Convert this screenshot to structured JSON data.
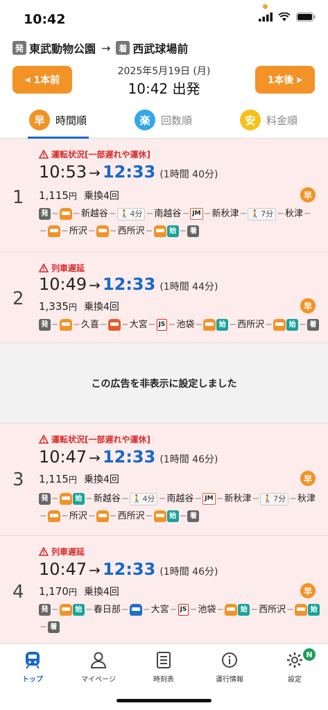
{
  "status": {
    "time": "10:42"
  },
  "route": {
    "from_badge": "発",
    "from": "東武動物公園",
    "arrow": "→",
    "to_badge": "着",
    "to": "西武球場前"
  },
  "nav": {
    "prev": "1本前",
    "next": "1本後",
    "date": "2025年5月19日 (月)",
    "departure": "10:42 出発"
  },
  "tabs": [
    {
      "icon": "早",
      "label": "時間順",
      "color": "#f39226"
    },
    {
      "icon": "楽",
      "label": "回数順",
      "color": "#35a6e8"
    },
    {
      "icon": "安",
      "label": "料金順",
      "color": "#f5c21b"
    }
  ],
  "results": [
    {
      "num": "1",
      "warning": "運転状況[一部遅れや運休]",
      "dep": "10:53",
      "arr": "12:33",
      "duration": "(1時間 40分)",
      "fare": "1,115",
      "yen": "円",
      "transfers": "乗換4回",
      "badge": "早",
      "stations": [
        "新越谷",
        "南越谷",
        "新秋津",
        "秋津",
        "所沢",
        "西所沢"
      ],
      "walk1": "4分",
      "walk2": "7分",
      "line": "JM",
      "start": "始",
      "dep_badge": "発",
      "arr_badge": "着"
    },
    {
      "num": "2",
      "warning": "列車遅延",
      "dep": "10:49",
      "arr": "12:33",
      "duration": "(1時間 44分)",
      "fare": "1,335",
      "yen": "円",
      "transfers": "乗換4回",
      "badge": "早",
      "stations": [
        "久喜",
        "大宮",
        "池袋",
        "西所沢"
      ],
      "line": "JS",
      "start": "始",
      "dep_badge": "発",
      "arr_badge": "着"
    },
    {
      "num": "3",
      "warning": "運転状況[一部遅れや運休]",
      "dep": "10:47",
      "arr": "12:33",
      "duration": "(1時間 46分)",
      "fare": "1,115",
      "yen": "円",
      "transfers": "乗換4回",
      "badge": "早",
      "stations": [
        "新越谷",
        "南越谷",
        "新秋津",
        "秋津",
        "所沢",
        "西所沢"
      ],
      "walk1": "4分",
      "walk2": "7分",
      "line": "JM",
      "start": "始",
      "dep_badge": "発",
      "arr_badge": "着"
    },
    {
      "num": "4",
      "warning": "列車遅延",
      "dep": "10:47",
      "arr": "12:33",
      "duration": "(1時間 46分)",
      "fare": "1,170",
      "yen": "円",
      "transfers": "乗換4回",
      "badge": "早",
      "stations": [
        "春日部",
        "大宮",
        "池袋",
        "西所沢"
      ],
      "line": "JS",
      "start": "始",
      "dep_badge": "発",
      "arr_badge": "着"
    }
  ],
  "arrow_sym": "→",
  "ad_text": "この広告を非表示に設定しました",
  "bottom_nav": [
    {
      "label": "トップ"
    },
    {
      "label": "マイページ"
    },
    {
      "label": "時刻表"
    },
    {
      "label": "運行情報"
    },
    {
      "label": "設定"
    }
  ],
  "settings_badge": "N"
}
